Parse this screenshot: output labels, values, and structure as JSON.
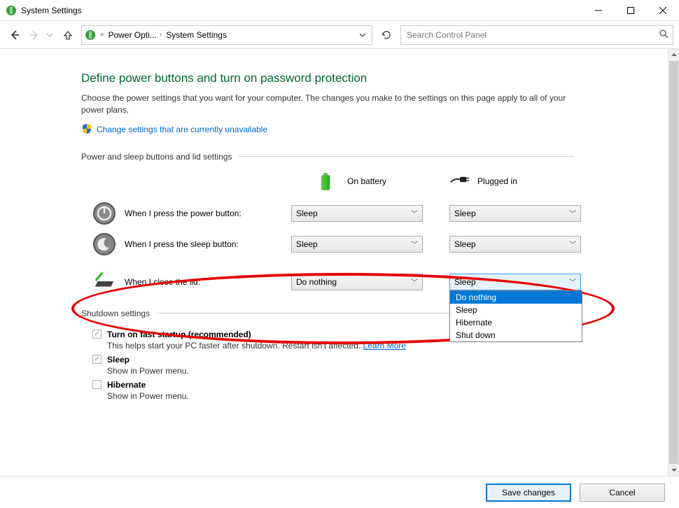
{
  "window": {
    "title": "System Settings"
  },
  "nav": {
    "crumb1": "Power Opti...",
    "crumb2": "System Settings",
    "search_placeholder": "Search Control Panel"
  },
  "page": {
    "title": "Define power buttons and turn on password protection",
    "desc": "Choose the power settings that you want for your computer. The changes you make to the settings on this page apply to all of your power plans.",
    "change_link": "Change settings that are currently unavailable",
    "section1": "Power and sleep buttons and lid settings",
    "col_battery": "On battery",
    "col_plugged": "Plugged in",
    "rows": [
      {
        "label": "When I press the power button:",
        "battery": "Sleep",
        "plugged": "Sleep"
      },
      {
        "label": "When I press the sleep button:",
        "battery": "Sleep",
        "plugged": "Sleep"
      },
      {
        "label": "When I close the lid:",
        "battery": "Do nothing",
        "plugged": "Sleep"
      }
    ],
    "dropdown_options": [
      "Do nothing",
      "Sleep",
      "Hibernate",
      "Shut down"
    ],
    "section2": "Shutdown settings",
    "shutdown": [
      {
        "label": "Turn on fast startup (recommended)",
        "checked": true,
        "bold": true,
        "sub": "This helps start your PC faster after shutdown. Restart isn't affected.",
        "learn": "Learn More"
      },
      {
        "label": "Sleep",
        "checked": true,
        "bold": true,
        "sub": "Show in Power menu."
      },
      {
        "label": "Hibernate",
        "checked": false,
        "bold": true,
        "sub": "Show in Power menu."
      }
    ]
  },
  "footer": {
    "save": "Save changes",
    "cancel": "Cancel"
  }
}
